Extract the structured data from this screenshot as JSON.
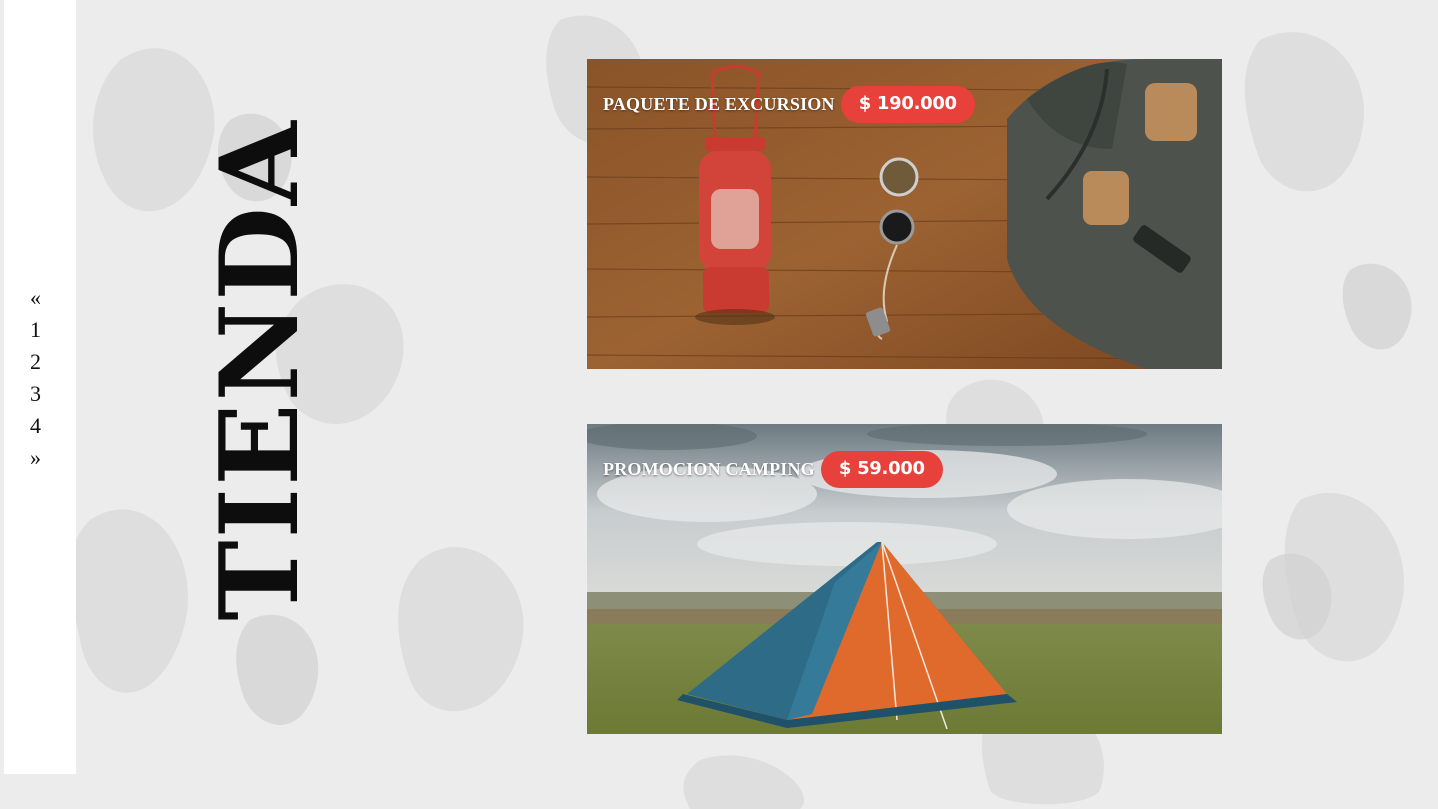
{
  "pagination": {
    "prev": "«",
    "pages": [
      "1",
      "2",
      "3",
      "4"
    ],
    "next": "»"
  },
  "page_title": "TIENDA",
  "products": [
    {
      "name": "PAQUETE DE EXCURSION",
      "price": "$ 190.000",
      "image": "lantern-compass-backpack-on-wood"
    },
    {
      "name": "PROMOCION CAMPING",
      "price": "$ 59.000",
      "image": "blue-orange-tent-on-grass"
    }
  ],
  "colors": {
    "background": "#ececec",
    "sidebar": "#ffffff",
    "price_badge": "#e8403a",
    "title": "#0d0d0d"
  }
}
